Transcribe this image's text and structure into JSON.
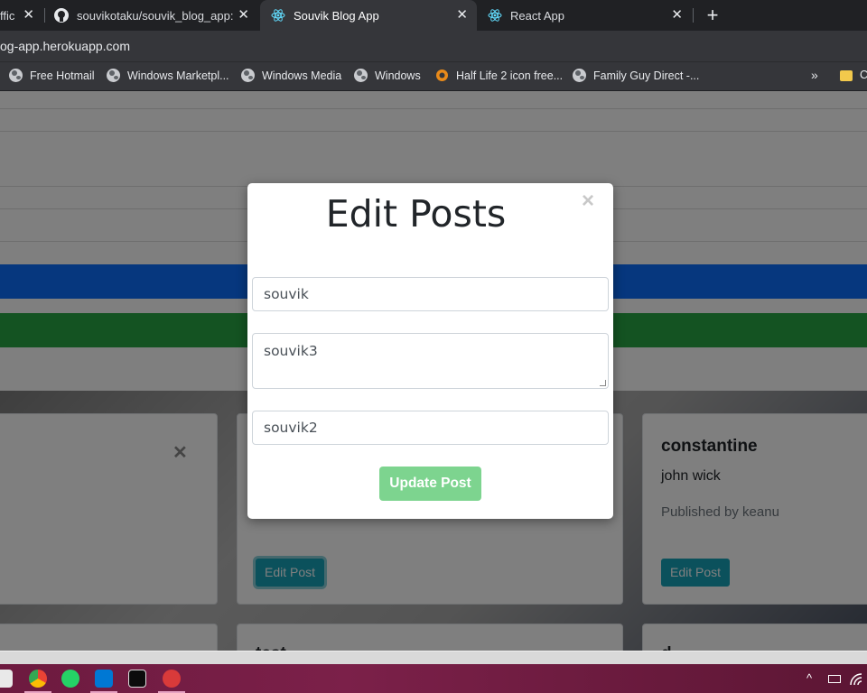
{
  "browser": {
    "tabs": [
      {
        "title": "ffic",
        "close": "✕",
        "active": false
      },
      {
        "title": "souvikotaku/souvik_blog_app: I m",
        "close": "✕",
        "active": false
      },
      {
        "title": "Souvik Blog App",
        "close": "✕",
        "active": true
      },
      {
        "title": "React App",
        "close": "✕",
        "active": false
      }
    ],
    "new_tab": "+",
    "url": "og-app.herokuapp.com",
    "bookmarks": [
      {
        "label": "Free Hotmail"
      },
      {
        "label": "Windows Marketpl..."
      },
      {
        "label": "Windows Media"
      },
      {
        "label": "Windows"
      },
      {
        "label": "Half Life 2 icon free..."
      },
      {
        "label": "Family Guy Direct -..."
      }
    ],
    "bookmarks_more": "»",
    "bookmark_folder_label": "C"
  },
  "page": {
    "cards": [
      {
        "close": "✕"
      },
      {
        "edit_label": "Edit Post"
      },
      {
        "title": "constantine",
        "text": "john wick",
        "meta": "Published by keanu",
        "edit_label": "Edit Post"
      }
    ],
    "row2_text": [
      "test",
      "d"
    ]
  },
  "modal": {
    "title": "Edit Posts",
    "close": "×",
    "fields": {
      "title_value": "souvik",
      "body_value": "souvik3",
      "author_value": "souvik2"
    },
    "update_label": "Update Post"
  },
  "colors": {
    "primary_bar": "#0d6efd",
    "success_bar": "#28a745",
    "edit_button": "#17a2b8",
    "update_button": "#7dd48f"
  }
}
